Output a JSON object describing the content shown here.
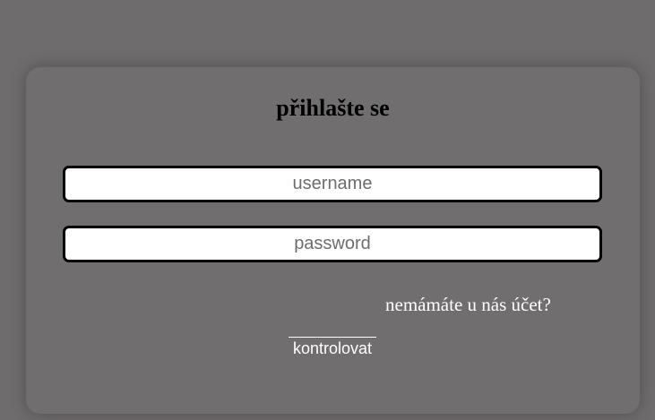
{
  "login": {
    "title": "přihlašte se",
    "username_placeholder": "username",
    "password_placeholder": "password",
    "register_link": "nemámáte u nás účet?",
    "submit_label": "kontrolovat"
  },
  "colors": {
    "background": "#6f6c6d",
    "card": "#716e6f",
    "input_bg": "#ffffff",
    "input_border": "#000000",
    "link_text": "#ffffff"
  }
}
